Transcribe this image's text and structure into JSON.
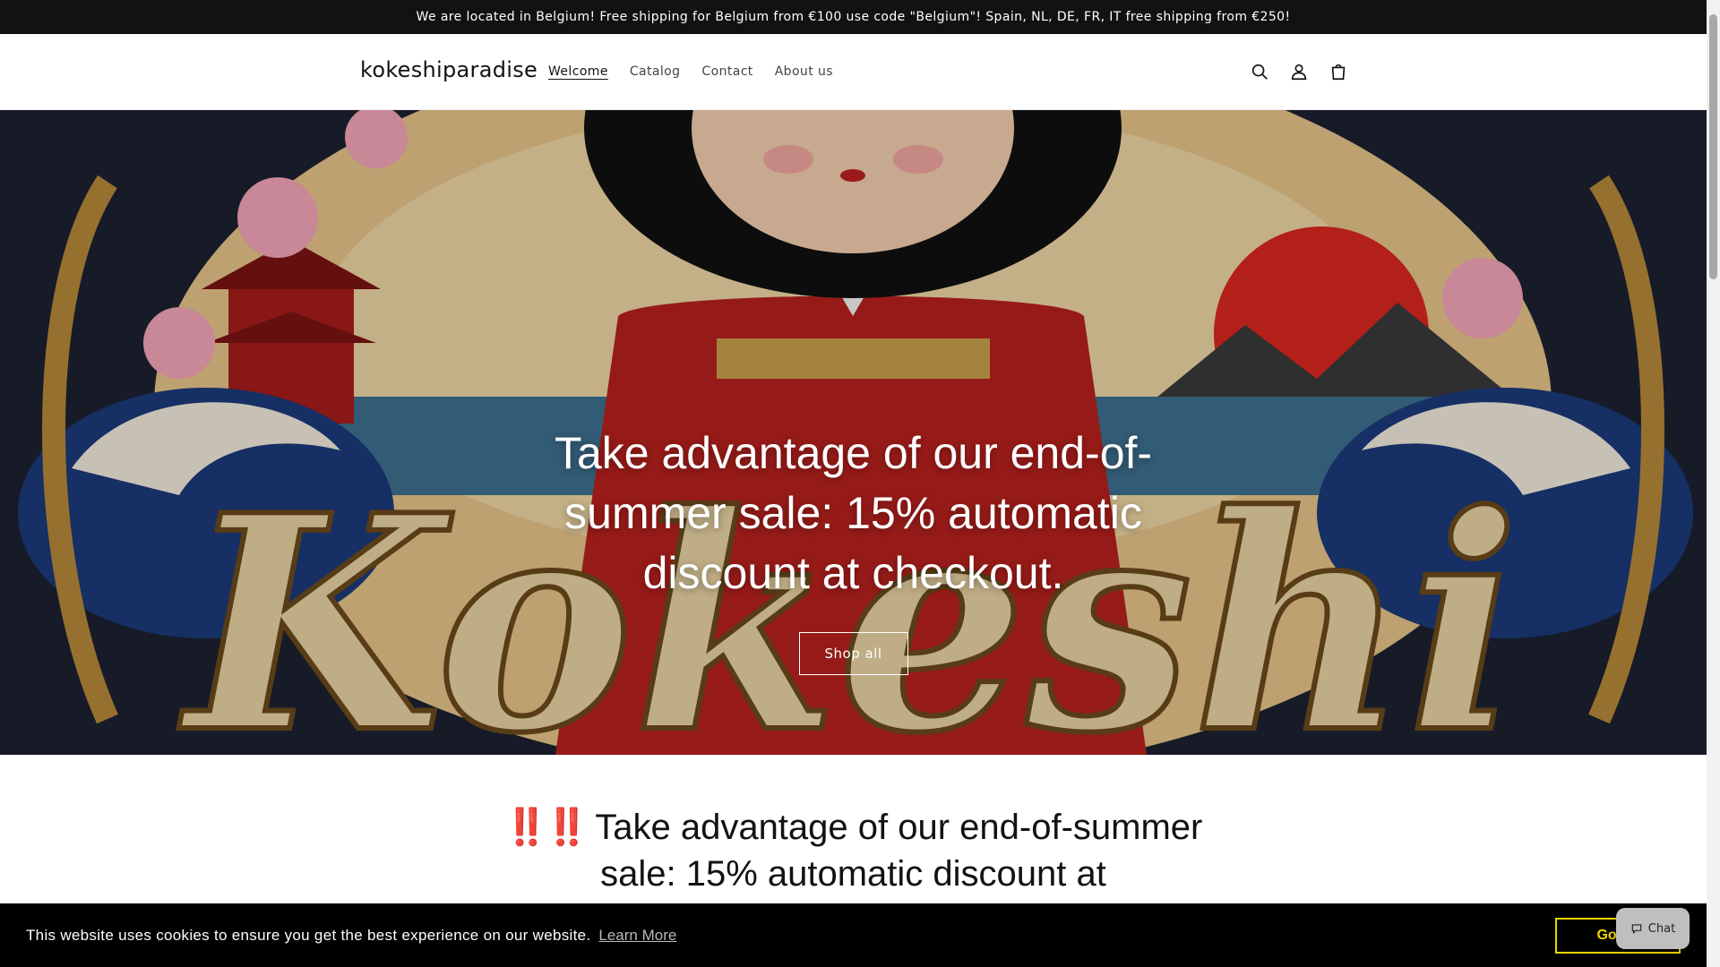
{
  "announcement": {
    "text": "We are located in Belgium! Free shipping for Belgium from €100 use code \"Belgium\"! Spain, NL, DE, FR, IT free shipping from €250!"
  },
  "header": {
    "logo": "kokeshiparadise",
    "nav": [
      {
        "label": "Welcome",
        "active": true
      },
      {
        "label": "Catalog",
        "active": false
      },
      {
        "label": "Contact",
        "active": false
      },
      {
        "label": "About us",
        "active": false
      }
    ],
    "icons": [
      "search-icon",
      "account-icon",
      "cart-icon"
    ]
  },
  "hero": {
    "heading": "Take advantage of our end-of-summer sale: 15% automatic discount at checkout.",
    "button": "Shop all",
    "image_text": "Kokeshi"
  },
  "promo": {
    "emoji": "‼️‼️",
    "text": "Take advantage of our end-of-summer sale: 15% automatic discount at"
  },
  "cookie": {
    "text": "This website uses cookies to ensure you get the best experience on our website.",
    "link": "Learn More",
    "button": "Got it!"
  },
  "chat": {
    "label": "Chat"
  },
  "colors": {
    "announcement_bg": "#121212",
    "cookie_bg": "#000000",
    "cookie_button": "#f1d600",
    "promo_emoji": "#e0282e"
  }
}
